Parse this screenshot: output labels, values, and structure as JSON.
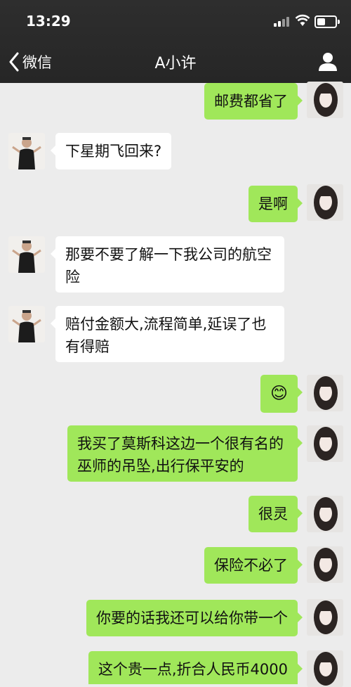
{
  "status_bar": {
    "time": "13:29"
  },
  "nav": {
    "back_label": "微信",
    "title": "A小许"
  },
  "messages": [
    {
      "side": "out",
      "text": "邮费都省了"
    },
    {
      "side": "in",
      "text": "下星期飞回来?"
    },
    {
      "side": "out",
      "text": "是啊"
    },
    {
      "side": "in",
      "text": "那要不要了解一下我公司的航空险"
    },
    {
      "side": "in",
      "text": "赔付金额大,流程简单,延误了也有得赔"
    },
    {
      "side": "out",
      "text": "😊",
      "emoji_name": "smile-emoji"
    },
    {
      "side": "out",
      "text": "我买了莫斯科这边一个很有名的巫师的吊坠,出行保平安的"
    },
    {
      "side": "out",
      "text": "很灵"
    },
    {
      "side": "out",
      "text": "保险不必了"
    },
    {
      "side": "out",
      "text": "你要的话我还可以给你带一个"
    },
    {
      "side": "out",
      "text": "这个贵一点,折合人民币4000"
    }
  ],
  "colors": {
    "header_bg": "#2a2a2a",
    "chat_bg": "#ececec",
    "outgoing_bubble": "#a0e75a",
    "incoming_bubble": "#ffffff"
  }
}
